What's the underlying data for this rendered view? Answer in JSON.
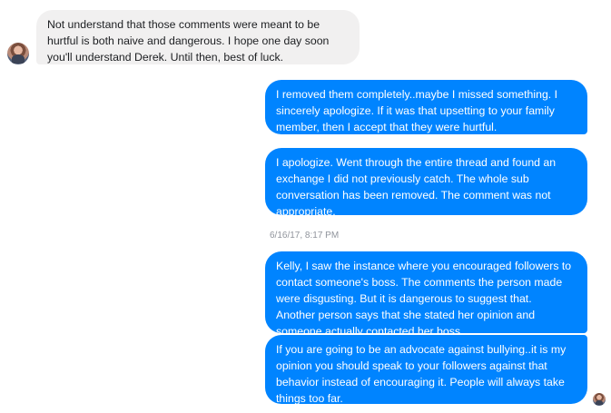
{
  "messages": [
    {
      "direction": "received",
      "text": "Not understand that those comments were meant to be\nhurtful is both naive and dangerous. I hope  one day soon\nyou'll understand Derek. Until then, best of luck."
    },
    {
      "direction": "sent",
      "text": "I removed them completely..maybe I missed something. I\nsincerely apologize. If it was that upsetting to your family\nmember, then I accept that they were hurtful."
    },
    {
      "direction": "sent",
      "text": "I apologize. Went through the entire thread and found an\nexchange I did not previously catch. The whole sub\nconversation has been removed. The comment was not\nappropriate."
    },
    {
      "direction": "sent",
      "text": "Kelly, I saw the instance where you encouraged followers to\ncontact someone's boss. The comments the person made\nwere disgusting. But it is dangerous to suggest that.\nAnother person says that she stated her opinion and\nsomeone actually contacted her boss."
    },
    {
      "direction": "sent",
      "text": "If you are going to be an advocate against bullying..it is my\nopinion you should speak to your followers against  that\nbehavior instead of encouraging it. People will always take\nthings too far."
    }
  ],
  "timestamp": "6/16/17, 8:17 PM",
  "colors": {
    "sent_bubble": "#0084ff",
    "received_bubble": "#f1f0f0",
    "timestamp_text": "#90949c"
  },
  "icons": {
    "received_avatar": "avatar-photo",
    "seen_avatar": "seen-avatar-photo"
  }
}
